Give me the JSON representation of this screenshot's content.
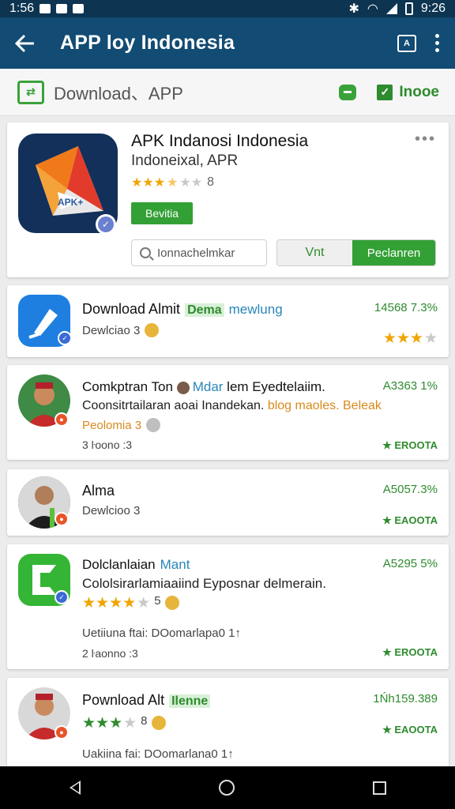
{
  "status": {
    "time": "1:56",
    "clock": "9:26"
  },
  "appbar": {
    "title": "APP loy Indonesia",
    "action_icon_label": "A"
  },
  "subbar": {
    "label": "Download、APP",
    "home_label": "Inooe"
  },
  "featured": {
    "title": "APK Indanosi Indonesia",
    "subtitle": "Indoneixal, APR",
    "rating_count": "8",
    "rating": 3.5,
    "install_label": "Bevitia",
    "search_placeholder": "Ionnachelmkar",
    "seg_a_label": "Vnt",
    "seg_b_label": "Peclanren",
    "icon_text": "APK+",
    "more": "•••"
  },
  "items": [
    {
      "title": "Download Almit",
      "tag": "Dema",
      "tag2": "mewlung",
      "subtitle": "Dewlciao 3",
      "percent": "14568 7.3%",
      "rating": 3,
      "emoji": true
    },
    {
      "title": "Comkptran Ton",
      "tag3": "Mdar",
      "title_rest": "lem Eyedtelaiim.",
      "desc1": "Coonsitrtailaran aoai Inandekan.",
      "desc_orange": "blog maoles. Beleak",
      "sub_orange": "Peolomia 3",
      "sub2": "3 ŀoono :3",
      "percent": "A3363 1%",
      "meta": "★ EROOTA"
    },
    {
      "title": "Alma",
      "subtitle": "Dewlcioo 3",
      "percent": "A5057.3%",
      "meta": "★ EAOOTA"
    },
    {
      "title": "Dolclanlaian",
      "tag2": "Mant",
      "desc1": "Cololsirarlamiaaiind Eyposnar delmerain.",
      "rating": 4,
      "rating_count": "5",
      "line1": "Uetiiuna ftai: DOomarlapa0 1↑",
      "line2": "2 ŀaonno :3",
      "percent": "A5295 5%",
      "meta": "★ EROOTA"
    },
    {
      "title": "Pownload Alt",
      "tag": "Ilenne",
      "rating": 3,
      "rating_count": "8",
      "line1": "Uakiina fai: DOomarlana0 1↑",
      "percent": "1Ńh159.389",
      "meta": "★ EAOOTA"
    }
  ],
  "colors": {
    "appbar": "#124b73",
    "status": "#0d3450",
    "accent_green": "#33a035",
    "star": "#f0a500"
  },
  "icons": [
    "back-arrow-icon",
    "account-icon",
    "more-vert-icon",
    "download-icon",
    "chat-icon",
    "check-icon",
    "search-icon",
    "verified-icon"
  ]
}
